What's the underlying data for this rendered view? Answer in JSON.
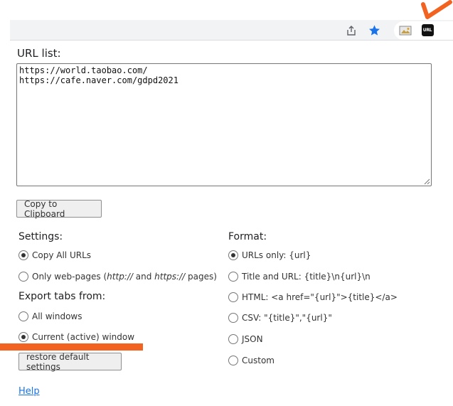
{
  "toolbar": {
    "icons": [
      "share-icon",
      "star-icon",
      "image-extension-icon",
      "url-extension-icon"
    ],
    "url_ext_badge": "URL",
    "star_color": "#1a73e8",
    "annotation_color": "#f26322"
  },
  "url_list": {
    "label": "URL list:",
    "lines": [
      "https://world.taobao.com/",
      "https://cafe.naver.com/gdpd2021"
    ]
  },
  "copy_button": "Copy to Clipboard",
  "settings": {
    "label": "Settings:",
    "options": [
      {
        "label": "Copy All URLs",
        "checked": true
      },
      {
        "label_prefix": "Only web-pages (",
        "http": "http://",
        "and": " and ",
        "https": "https://",
        "label_suffix": " pages)",
        "checked": false
      }
    ]
  },
  "export": {
    "label": "Export tabs from:",
    "options": [
      {
        "label": "All windows",
        "checked": false
      },
      {
        "label": "Current (active) window",
        "checked": true
      }
    ]
  },
  "restore_button": "restore default settings",
  "format": {
    "label": "Format:",
    "options": [
      {
        "label": "URLs only: {url}",
        "checked": true
      },
      {
        "label": "Title and URL: {title}\\n{url}\\n",
        "checked": false
      },
      {
        "label": "HTML: <a href=\"{url}\">{title}</a>",
        "checked": false
      },
      {
        "label": "CSV: \"{title}\",\"{url}\"",
        "checked": false
      },
      {
        "label": "JSON",
        "checked": false
      },
      {
        "label": "Custom",
        "checked": false
      }
    ]
  },
  "help_link": "Help"
}
